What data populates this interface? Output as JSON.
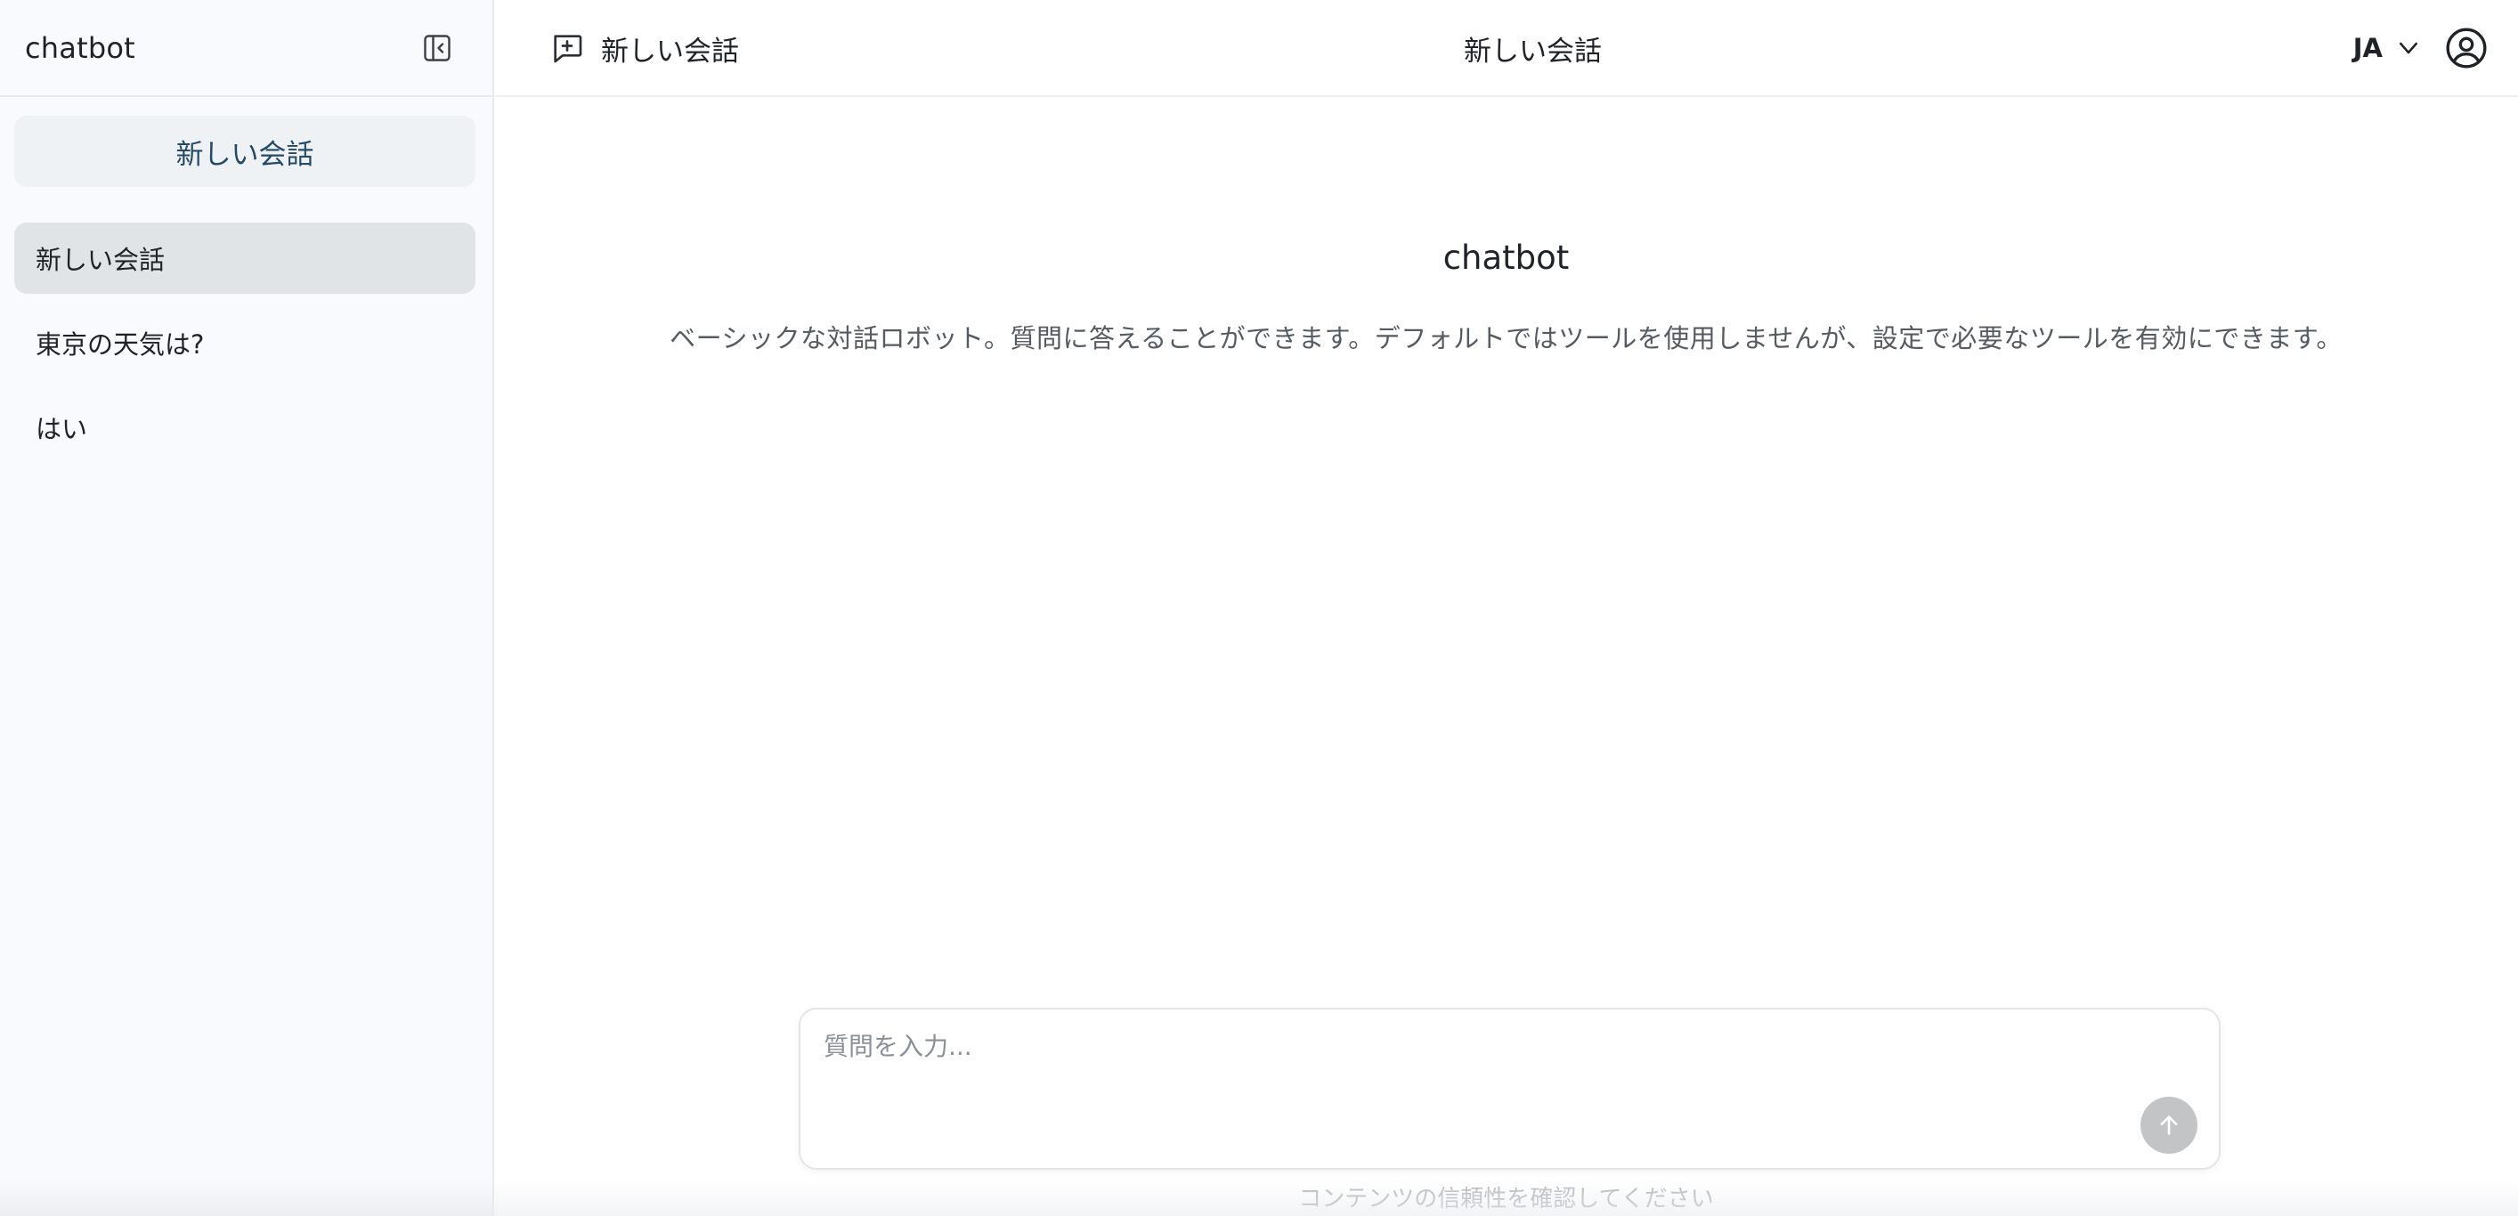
{
  "sidebar": {
    "app_title": "chatbot",
    "collapse_icon": "sidebar-collapse-icon",
    "new_chat_label": "新しい会話",
    "conversations": [
      {
        "label": "新しい会話",
        "active": true
      },
      {
        "label": "東京の天気は?",
        "active": false
      },
      {
        "label": "はい",
        "active": false
      }
    ]
  },
  "topbar": {
    "new_chat_label": "新しい会話",
    "new_chat_icon": "message-plus-icon",
    "title": "新しい会話",
    "language": "JA",
    "language_icon": "chevron-down-icon",
    "user_icon": "user-circle-icon"
  },
  "welcome": {
    "title": "chatbot",
    "description": "ベーシックな対話ロボット。質問に答えることができます。デフォルトではツールを使用しませんが、設定で必要なツールを有効にできます。"
  },
  "composer": {
    "placeholder": "質問を入力...",
    "value": "",
    "send_icon": "arrow-up-icon"
  },
  "footer": {
    "disclaimer": "コンテンツの信頼性を確認してください"
  },
  "colors": {
    "sidebar_bg": "#f8fafd",
    "active_item_bg": "#e1e4e6",
    "new_chat_text": "#254a66",
    "send_button_disabled": "#c2c4c6"
  }
}
